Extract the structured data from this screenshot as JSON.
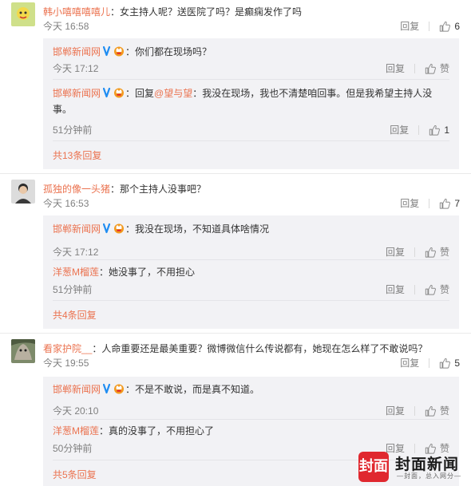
{
  "labels": {
    "reply": "回复",
    "like": "赞"
  },
  "comments": [
    {
      "user": "韩小嘻嘻嘻嘻儿",
      "text": "：女主持人呢？送医院了吗？是癫痫发作了吗",
      "time": "今天 16:58",
      "likes": "6",
      "replies": [
        {
          "user": "邯郸新闻网",
          "text": "：你们都在现场吗？",
          "time": "今天 17:12",
          "likes": ""
        },
        {
          "user": "邯郸新闻网",
          "reply_prefix": "：回复",
          "reply_to": "@望与望",
          "text": "：我没在现场，我也不清楚咱回事。但是我希望主持人没事。",
          "time": "51分钟前",
          "likes": "1"
        }
      ],
      "more": "共13条回复"
    },
    {
      "user": "孤独的像一头猪",
      "text": "：那个主持人没事吧？",
      "time": "今天 16:53",
      "likes": "7",
      "replies": [
        {
          "user": "邯郸新闻网",
          "text": "：我没在现场，不知道具体啥情况",
          "time": "今天 17:12",
          "likes": ""
        },
        {
          "user": "洋葱M榴莲",
          "text": "：她没事了，不用担心",
          "time": "51分钟前",
          "likes": ""
        }
      ],
      "more": "共4条回复"
    },
    {
      "user": "看家护院__",
      "text": "：人命重要还是最美重要？微博微信什么传说都有，她现在怎么样了不敢说吗？",
      "time": "今天 19:55",
      "likes": "5",
      "replies": [
        {
          "user": "邯郸新闻网",
          "text": "：不是不敢说，而是真不知道。",
          "time": "今天 20:10",
          "likes": ""
        },
        {
          "user": "洋葱M榴莲",
          "text": "：真的没事了，不用担心了",
          "time": "50分钟前",
          "likes": ""
        }
      ],
      "more": "共5条回复"
    }
  ],
  "watermark": {
    "mark": "封面",
    "name": "封面新闻",
    "slogan": "—封面，总入网分—"
  },
  "colors": {
    "username": "#eb7350",
    "subBackground": "#f2f2f5",
    "brand": "#e0282f"
  }
}
